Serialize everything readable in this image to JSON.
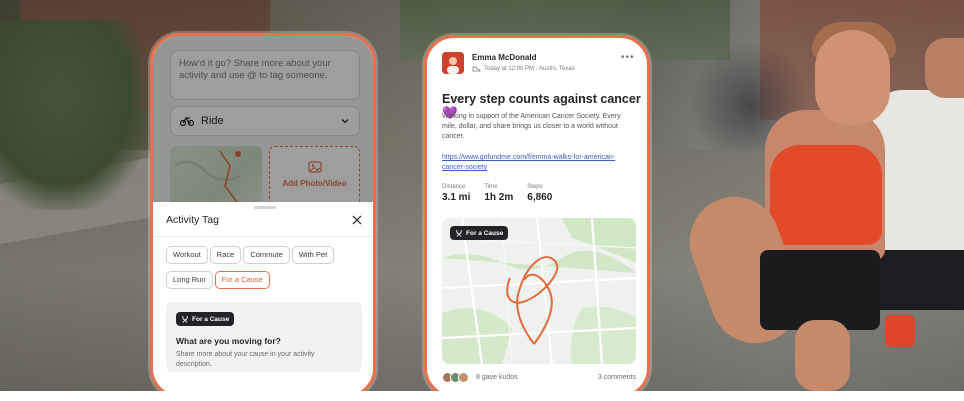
{
  "colors": {
    "accent": "#e8714c",
    "dark": "#242428",
    "link": "#3b5cc7",
    "heart": "#8d4fd6"
  },
  "record": {
    "description_placeholder": "How'd it go? Share more about your activity and use @ to tag someone.",
    "sport_type": "Ride",
    "sport_icon": "bike-icon",
    "add_media_label": "Add Photo/Video"
  },
  "activity_tag_sheet": {
    "title": "Activity Tag",
    "tags": [
      "Workout",
      "Race",
      "Commute",
      "With Pet",
      "Long Run",
      "For a Cause"
    ],
    "selected_tag": "For a Cause",
    "card": {
      "badge": "For a Cause",
      "question": "What are you moving for?",
      "description": "Share more about your cause in your activity description."
    }
  },
  "post": {
    "author": "Emma McDonald",
    "meta": "Today at 12:00 PM · Austin, Texas",
    "title": "Every step counts against cancer",
    "title_emoji": "💜",
    "body": "Walking in support of the American Cancer Society. Every mile, dollar, and share brings us closer to a world without cancer.",
    "link": "https://www.gofundme.com/f/emma-walks-for-american-cancer-society",
    "stats": [
      {
        "label": "Distance",
        "value": "3.1 mi"
      },
      {
        "label": "Time",
        "value": "1h 2m"
      },
      {
        "label": "Steps",
        "value": "6,860"
      }
    ],
    "map_badge": "For a Cause",
    "kudos": "8 gave kudos",
    "comments": "3 comments"
  }
}
